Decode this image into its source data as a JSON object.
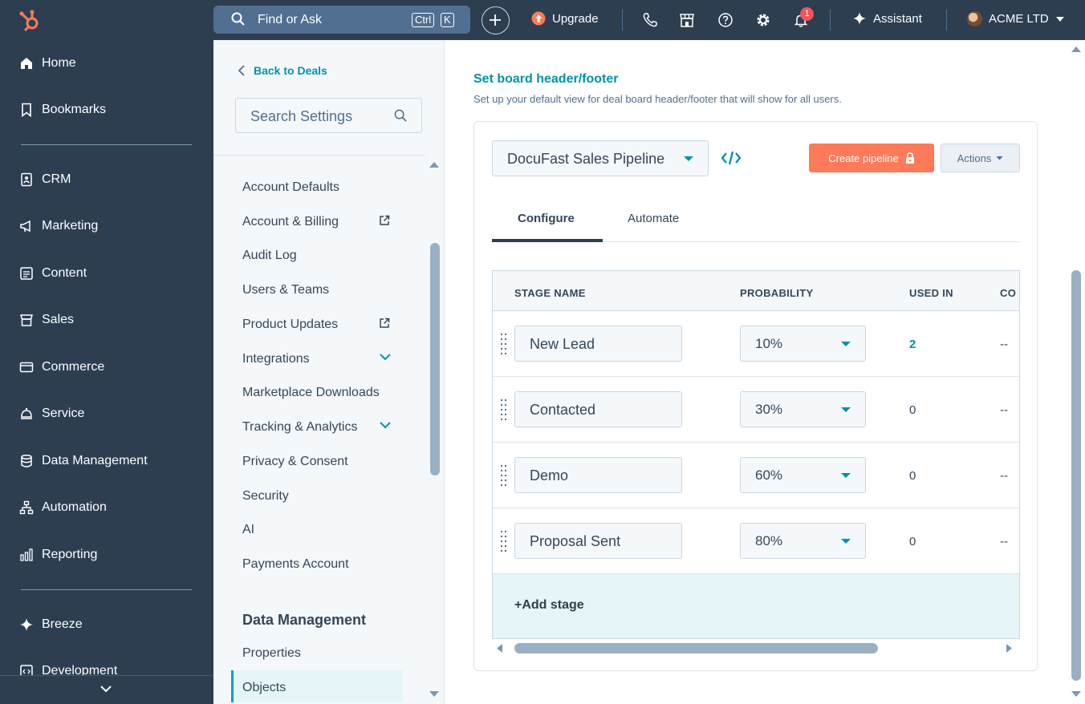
{
  "topbar": {
    "search_text": "Find or Ask",
    "kbd_ctrl": "Ctrl",
    "kbd_k": "K",
    "upgrade": "Upgrade",
    "notifications_count": "1",
    "assistant": "Assistant",
    "account": "ACME LTD"
  },
  "nav": {
    "items": [
      "Home",
      "Bookmarks",
      "CRM",
      "Marketing",
      "Content",
      "Sales",
      "Commerce",
      "Service",
      "Data Management",
      "Automation",
      "Reporting",
      "Breeze",
      "Development"
    ]
  },
  "settings": {
    "back": "Back to Deals",
    "search_placeholder": "Search Settings",
    "items": [
      "Account Defaults",
      "Account & Billing",
      "Audit Log",
      "Users & Teams",
      "Product Updates",
      "Integrations",
      "Marketplace Downloads",
      "Tracking & Analytics",
      "Privacy & Consent",
      "Security",
      "AI",
      "Payments Account"
    ],
    "heading_data": "Data Management",
    "data_items": [
      "Properties",
      "Objects"
    ]
  },
  "main": {
    "title": "Set board header/footer",
    "subtitle": "Set up your default view for deal board header/footer that will show for all users.",
    "pipeline": "DocuFast Sales Pipeline",
    "create_pipeline": "Create pipeline",
    "actions": "Actions",
    "tabs": [
      "Configure",
      "Automate"
    ],
    "table": {
      "headers": [
        "STAGE NAME",
        "PROBABILITY",
        "USED IN",
        "CO"
      ],
      "rows": [
        {
          "stage": "New Lead",
          "probability": "10%",
          "used_in": "2",
          "extra": "--"
        },
        {
          "stage": "Contacted",
          "probability": "30%",
          "used_in": "0",
          "extra": "--"
        },
        {
          "stage": "Demo",
          "probability": "60%",
          "used_in": "0",
          "extra": "--"
        },
        {
          "stage": "Proposal Sent",
          "probability": "80%",
          "used_in": "0",
          "extra": "--"
        }
      ],
      "add_stage": "+Add stage"
    }
  },
  "colors": {
    "nav_bg": "#2d3e50",
    "link": "#0091ae",
    "cta": "#ff7a59",
    "active_bg": "#e5f5f8"
  }
}
